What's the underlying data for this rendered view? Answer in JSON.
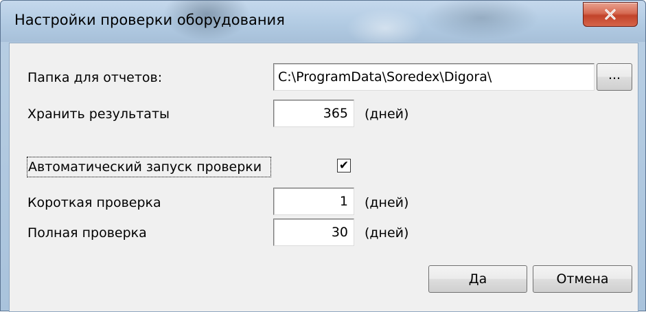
{
  "window": {
    "title": "Настройки проверки оборудования",
    "close_glyph": "X"
  },
  "form": {
    "reports_folder": {
      "label": "Папка для отчетов:",
      "value": "C:\\ProgramData\\Soredex\\Digora\\",
      "browse_label": "..."
    },
    "keep_results": {
      "label": "Хранить результаты",
      "value": "365",
      "unit": "(дней)"
    },
    "auto_start": {
      "label": "Автоматический запуск проверки",
      "checked": true,
      "check_glyph": "✔"
    },
    "short_check": {
      "label": "Короткая проверка",
      "value": "1",
      "unit": "(дней)"
    },
    "full_check": {
      "label": "Полная проверка",
      "value": "30",
      "unit": "(дней)"
    }
  },
  "buttons": {
    "ok_label": "Да",
    "cancel_label": "Отмена"
  },
  "colors": {
    "client_bg": "#f0f0f0",
    "close_button": "#c2432a",
    "title_bar": "#b2cbe3"
  },
  "icons": {
    "close": "close-icon",
    "checkbox": "checkmark-icon"
  }
}
